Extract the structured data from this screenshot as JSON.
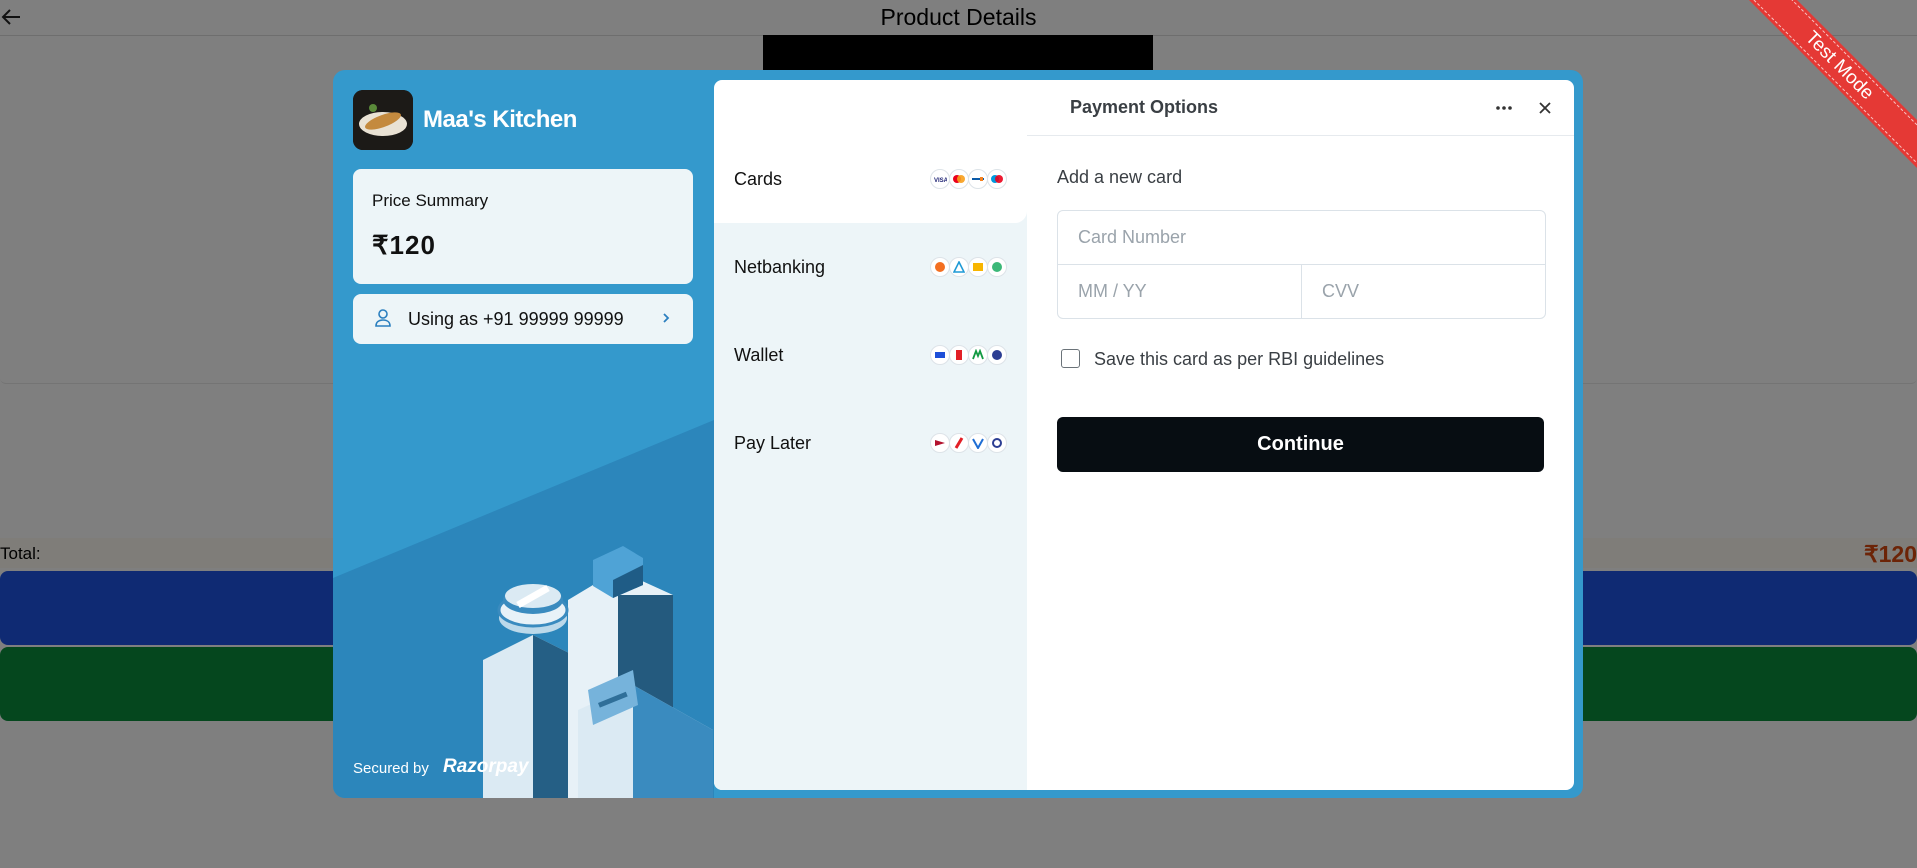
{
  "background": {
    "title": "Product Details",
    "total_label": "Total:",
    "total_value": "₹120",
    "ribbon": "Test Mode"
  },
  "checkout": {
    "merchant_name": "Maa's Kitchen",
    "price_summary_label": "Price Summary",
    "price": "₹120",
    "user_text": "Using as +91 99999 99999",
    "secured_by": "Secured by",
    "brand": "Razorpay",
    "title": "Payment Options",
    "methods": [
      {
        "label": "Cards",
        "icons": [
          "visa-icon",
          "mastercard-icon",
          "rupay-icon",
          "maestro-icon"
        ]
      },
      {
        "label": "Netbanking",
        "icons": [
          "bank-icon",
          "bank-icon",
          "bank-icon",
          "bank-icon"
        ]
      },
      {
        "label": "Wallet",
        "icons": [
          "wallet-icon",
          "wallet-icon",
          "wallet-icon",
          "wallet-icon"
        ]
      },
      {
        "label": "Pay Later",
        "icons": [
          "paylater-icon",
          "paylater-icon",
          "paylater-icon",
          "paylater-icon"
        ]
      }
    ],
    "form": {
      "heading": "Add a new card",
      "card_number_placeholder": "Card Number",
      "expiry_placeholder": "MM / YY",
      "cvv_placeholder": "CVV",
      "save_card_label": "Save this card as per RBI guidelines",
      "continue_label": "Continue"
    }
  },
  "colors": {
    "panel_blue": "#3499cc",
    "primary_button": "#070d12",
    "ribbon_red": "#e53935",
    "total_orange": "#d9480f"
  }
}
